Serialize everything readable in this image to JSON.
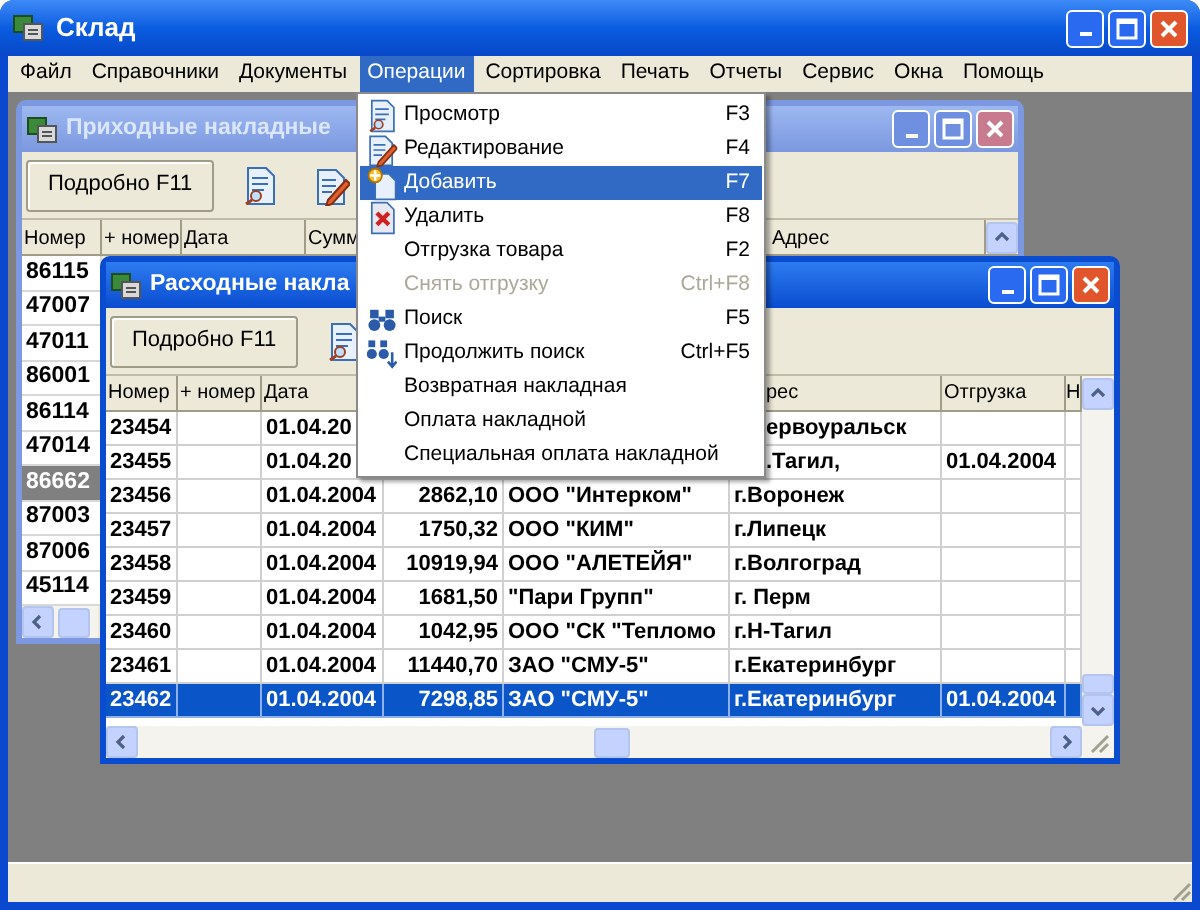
{
  "app": {
    "title": "Склад"
  },
  "menubar": [
    {
      "label": "Файл",
      "selected": false
    },
    {
      "label": "Справочники",
      "selected": false
    },
    {
      "label": "Документы",
      "selected": false
    },
    {
      "label": "Операции",
      "selected": true
    },
    {
      "label": "Сортировка",
      "selected": false
    },
    {
      "label": "Печать",
      "selected": false
    },
    {
      "label": "Отчеты",
      "selected": false
    },
    {
      "label": "Сервис",
      "selected": false
    },
    {
      "label": "Окна",
      "selected": false
    },
    {
      "label": "Помощь",
      "selected": false
    }
  ],
  "windows": [
    {
      "title": "Приходные накладные",
      "active": false,
      "button": "Подробно F11",
      "columns": [
        "Номер",
        "+ номер",
        "Дата",
        "Сумм",
        "Адрес"
      ],
      "rows": [
        {
          "number": "86115",
          "selected": false
        },
        {
          "number": "47007",
          "selected": false
        },
        {
          "number": "47011",
          "selected": false
        },
        {
          "number": "86001",
          "selected": false
        },
        {
          "number": "86114",
          "selected": false
        },
        {
          "number": "47014",
          "selected": false
        },
        {
          "number": "86662",
          "selected": true
        },
        {
          "number": "87003",
          "selected": false
        },
        {
          "number": "87006",
          "selected": false
        },
        {
          "number": "45114",
          "selected": false
        }
      ]
    },
    {
      "title": "Расходные накла",
      "active": true,
      "button": "Подробно F11",
      "columns": [
        {
          "label": "Номер"
        },
        {
          "label": "+ номер"
        },
        {
          "label": "Дата"
        },
        {
          "label": "рес",
          "under_menu": true
        },
        {
          "label": "Отгрузка"
        },
        {
          "label": "Н"
        }
      ],
      "rows": [
        {
          "number": "23454",
          "date": "01.04.20",
          "address": "ервоуральск",
          "under_menu": true,
          "selected": false
        },
        {
          "number": "23455",
          "date": "01.04.20",
          "address": ".Тагил,",
          "shipped": "01.04.2004",
          "under_menu": true,
          "selected": false
        },
        {
          "number": "23456",
          "date": "01.04.2004",
          "sum": "2862,10",
          "buyer": "ООО \"Интерком\"",
          "address": "г.Воронеж",
          "selected": false
        },
        {
          "number": "23457",
          "date": "01.04.2004",
          "sum": "1750,32",
          "buyer": "ООО \"КИМ\"",
          "address": "г.Липецк",
          "selected": false
        },
        {
          "number": "23458",
          "date": "01.04.2004",
          "sum": "10919,94",
          "buyer": "ООО \"АЛЕТЕЙЯ\"",
          "address": "г.Волгоград",
          "selected": false
        },
        {
          "number": "23459",
          "date": "01.04.2004",
          "sum": "1681,50",
          "buyer": "\"Пари Групп\"",
          "address": "г. Перм",
          "selected": false
        },
        {
          "number": "23460",
          "date": "01.04.2004",
          "sum": "1042,95",
          "buyer": "ООО \"СК \"Тепломо",
          "address": "г.Н-Тагил",
          "selected": false
        },
        {
          "number": "23461",
          "date": "01.04.2004",
          "sum": "11440,70",
          "buyer": "ЗАО \"СМУ-5\"",
          "address": "г.Екатеринбург",
          "selected": false
        },
        {
          "number": "23462",
          "date": "01.04.2004",
          "sum": "7298,85",
          "buyer": "ЗАО \"СМУ-5\"",
          "address": "г.Екатеринбург",
          "shipped": "01.04.2004",
          "selected": true
        }
      ]
    }
  ],
  "menu": [
    {
      "label": "Просмотр",
      "shortcut": "F3",
      "kind": "view",
      "disabled": false,
      "selected": false
    },
    {
      "label": "Редактирование",
      "shortcut": "F4",
      "kind": "edit",
      "disabled": false,
      "selected": false
    },
    {
      "label": "Добавить",
      "shortcut": "F7",
      "kind": "add",
      "disabled": false,
      "selected": true
    },
    {
      "label": "Удалить",
      "shortcut": "F8",
      "kind": "delete",
      "disabled": false,
      "selected": false
    },
    {
      "label": "Отгрузка товара",
      "shortcut": "F2",
      "disabled": false,
      "selected": false
    },
    {
      "label": "Снять отгрузку",
      "shortcut": "Ctrl+F8",
      "disabled": true,
      "selected": false
    },
    {
      "label": "Поиск",
      "shortcut": "F5",
      "kind": "search",
      "disabled": false,
      "selected": false
    },
    {
      "label": "Продолжить поиск",
      "shortcut": "Ctrl+F5",
      "kind": "next",
      "disabled": false,
      "selected": false
    },
    {
      "label": "Возвратная накладная",
      "disabled": false,
      "selected": false
    },
    {
      "label": "Оплата накладной",
      "disabled": false,
      "selected": false
    },
    {
      "label": "Специальная оплата накладной",
      "disabled": false,
      "selected": false
    }
  ]
}
